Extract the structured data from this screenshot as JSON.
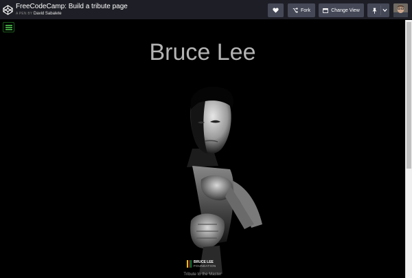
{
  "header": {
    "title": "FreeCodeCamp: Build a tribute page",
    "byline_prefix": "A PEN BY",
    "author": "David Sabalete",
    "buttons": {
      "fork": "Fork",
      "change_view": "Change View"
    },
    "icons": [
      "codepen-logo-icon",
      "heart-icon",
      "fork-icon",
      "layout-icon",
      "pin-icon",
      "chevron-down-icon"
    ]
  },
  "page": {
    "title": "Bruce Lee",
    "logo": {
      "name": "BRUCE LEE",
      "subtitle": "FOUNDATION",
      "colors": [
        "#e8c517",
        "#d23a1c",
        "#1a7a3a"
      ]
    },
    "caption": "Tribute to the Master"
  },
  "colors": {
    "header_bg": "#1e1f26",
    "button_bg": "#444857",
    "page_bg": "#000000",
    "title_color": "#b3b3b3",
    "hamburger": "#3fa13f"
  }
}
